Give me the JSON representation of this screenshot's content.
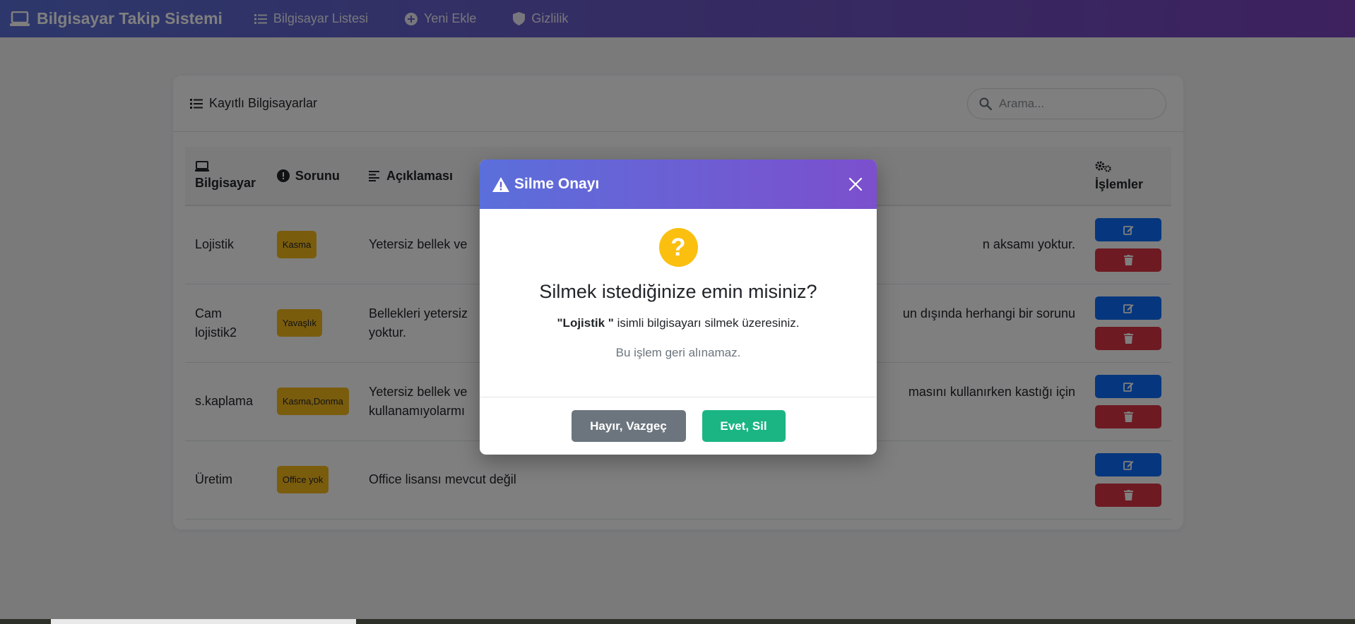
{
  "navbar": {
    "brand": "Bilgisayar Takip Sistemi",
    "items": [
      {
        "label": "Bilgisayar Listesi"
      },
      {
        "label": "Yeni Ekle"
      },
      {
        "label": "Gizlilik"
      }
    ]
  },
  "card": {
    "title": "Kayıtlı Bilgisayarlar",
    "search_placeholder": "Arama..."
  },
  "table": {
    "headers": {
      "computer": "Bilgisayar",
      "issue": "Sorunu",
      "description": "Açıklaması",
      "actions": "İşlemler"
    },
    "rows": [
      {
        "computer": "Lojistik",
        "issue": "Kasma",
        "desc_left": "Yetersiz bellek ve",
        "desc_right": "n aksamı yoktur."
      },
      {
        "computer": "Cam lojistik2",
        "issue": "Yavaşlık",
        "desc_left": "Bellekleri yetersiz",
        "desc_left2": "yoktur.",
        "desc_right": "un dışında herhangi bir sorunu"
      },
      {
        "computer": "s.kaplama",
        "issue": "Kasma,Donma",
        "desc_left": "Yetersiz bellek ve",
        "desc_left2": "kullanamıyolarmı",
        "desc_right": "masını kullanırken kastığı için"
      },
      {
        "computer": "Üretim",
        "issue": "Office yok",
        "desc_left": "Office lisansı mevcut değil",
        "desc_right": ""
      }
    ]
  },
  "modal": {
    "title": "Silme Onayı",
    "heading": "Silmek istediğinize emin misiniz?",
    "item_name": "\"Lojistik \"",
    "message_suffix": " isimli bilgisayarı silmek üzeresiniz.",
    "note": "Bu işlem geri alınamaz.",
    "cancel_label": "Hayır, Vazgeç",
    "confirm_label": "Evet, Sil",
    "question_mark": "?"
  },
  "colors": {
    "nav_gradient_start": "#5a6fd6",
    "nav_gradient_end": "#7a44bd",
    "badge": "#f4b91a",
    "edit": "#0d6efd",
    "delete": "#dc3545",
    "cancel": "#6c757d",
    "confirm": "#1bb584",
    "warning": "#fbbf0f"
  }
}
